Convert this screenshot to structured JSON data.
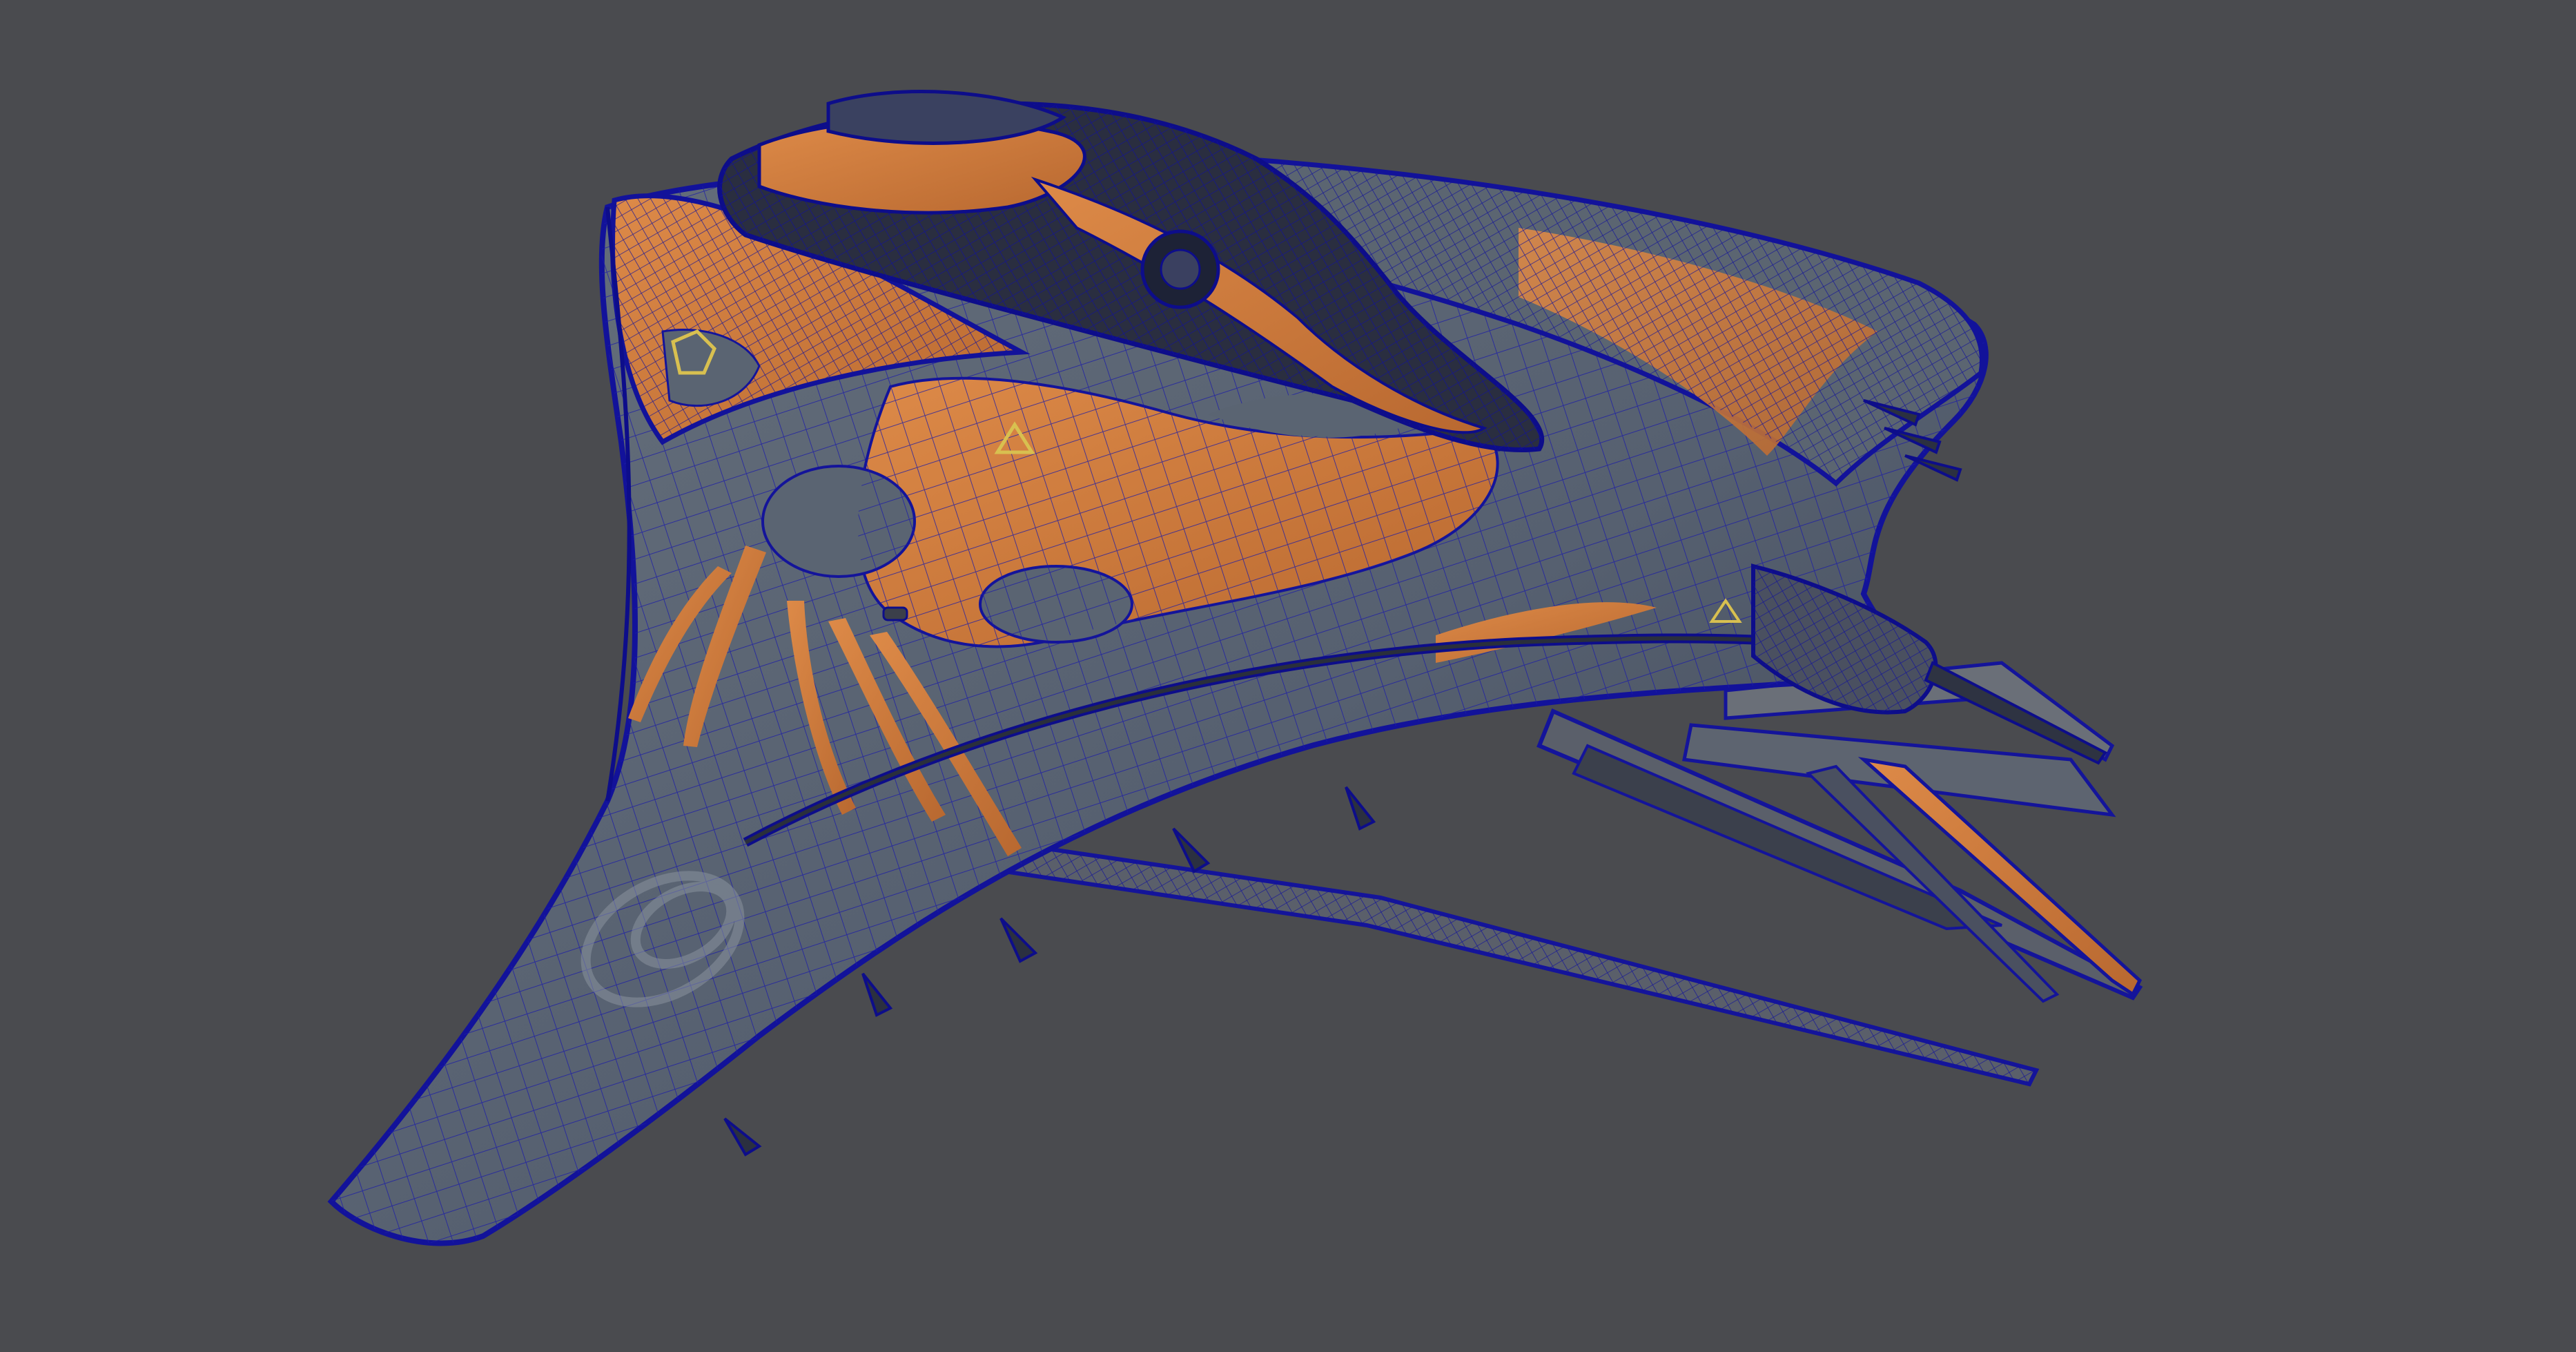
{
  "scene": {
    "subject": "spaceship-wireframe-render",
    "colors": {
      "background": "#4a4b4f",
      "hull_grey": "#5b6470",
      "hull_dark": "#3f4652",
      "hull_orange": "#d07a3c",
      "wire_blue": "#1a1aa8",
      "wire_dense": "#0d0d8a",
      "cockpit_dark": "#232634"
    }
  }
}
